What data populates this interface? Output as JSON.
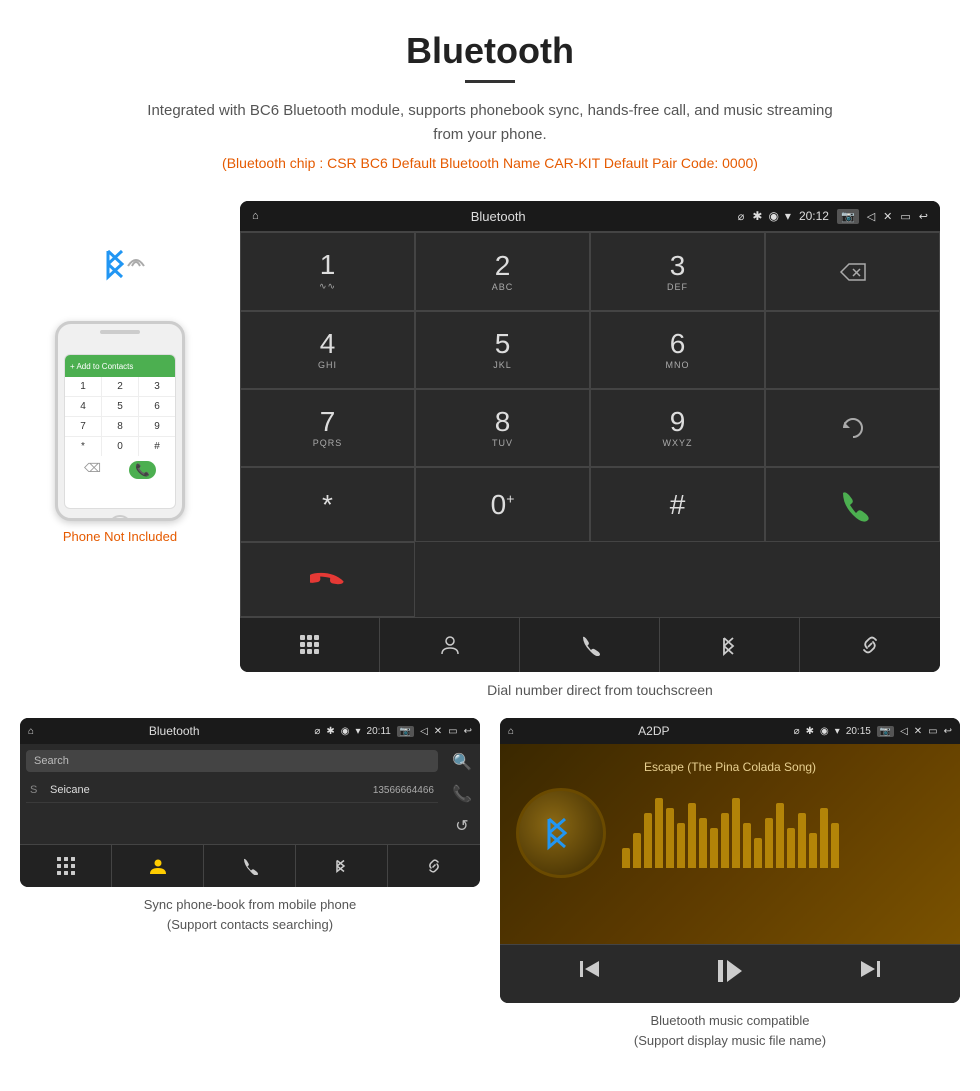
{
  "header": {
    "title": "Bluetooth",
    "description": "Integrated with BC6 Bluetooth module, supports phonebook sync, hands-free call, and music streaming from your phone.",
    "specs": "(Bluetooth chip : CSR BC6    Default Bluetooth Name CAR-KIT    Default Pair Code: 0000)"
  },
  "dial_screen": {
    "status_bar": {
      "home_icon": "⌂",
      "title": "Bluetooth",
      "usb_icon": "⌀",
      "bt_icon": "✱",
      "location_icon": "◉",
      "wifi_icon": "▾",
      "time": "20:12",
      "camera_icon": "⬜",
      "volume_icon": "◁",
      "close_icon": "✕",
      "window_icon": "▭",
      "back_icon": "↩"
    },
    "keys": [
      {
        "num": "1",
        "sub": "∿∿",
        "col": 0,
        "row": 0
      },
      {
        "num": "2",
        "sub": "ABC",
        "col": 1,
        "row": 0
      },
      {
        "num": "3",
        "sub": "DEF",
        "col": 2,
        "row": 0
      },
      {
        "num": "4",
        "sub": "GHI",
        "col": 0,
        "row": 1
      },
      {
        "num": "5",
        "sub": "JKL",
        "col": 1,
        "row": 1
      },
      {
        "num": "6",
        "sub": "MNO",
        "col": 2,
        "row": 1
      },
      {
        "num": "7",
        "sub": "PQRS",
        "col": 0,
        "row": 2
      },
      {
        "num": "8",
        "sub": "TUV",
        "col": 1,
        "row": 2
      },
      {
        "num": "9",
        "sub": "WXYZ",
        "col": 2,
        "row": 2
      },
      {
        "num": "*",
        "sub": "",
        "col": 0,
        "row": 3
      },
      {
        "num": "0⁺",
        "sub": "",
        "col": 1,
        "row": 3
      },
      {
        "num": "#",
        "sub": "",
        "col": 2,
        "row": 3
      }
    ],
    "bottom_icons": [
      "⋮⋮⋮",
      "👤",
      "📞",
      "✱",
      "🔗"
    ],
    "caption": "Dial number direct from touchscreen"
  },
  "phonebook_screen": {
    "status_bar": {
      "home_icon": "⌂",
      "title": "Bluetooth",
      "usb_icon": "⌀",
      "bt_icon": "✱",
      "location_icon": "◉",
      "wifi_icon": "▾",
      "time": "20:11",
      "camera_icon": "⬜",
      "volume_icon": "◁",
      "close_icon": "✕",
      "window_icon": "▭",
      "back_icon": "↩"
    },
    "search_placeholder": "Search",
    "contacts": [
      {
        "letter": "S",
        "name": "Seicane",
        "phone": "13566664466"
      }
    ],
    "bottom_icons": [
      "⋮⋮⋮",
      "👤",
      "📞",
      "✱",
      "🔗"
    ],
    "caption_line1": "Sync phone-book from mobile phone",
    "caption_line2": "(Support contacts searching)"
  },
  "music_screen": {
    "status_bar": {
      "home_icon": "⌂",
      "title": "A2DP",
      "usb_icon": "⌀",
      "bt_icon": "✱",
      "location_icon": "◉",
      "wifi_icon": "▾",
      "time": "20:15",
      "camera_icon": "⬜",
      "volume_icon": "◁",
      "close_icon": "✕",
      "window_icon": "▭",
      "back_icon": "↩"
    },
    "song_name": "Escape (The Pina Colada Song)",
    "eq_bars": [
      20,
      35,
      55,
      70,
      60,
      45,
      65,
      50,
      40,
      55,
      70,
      45,
      30,
      50,
      65,
      40,
      55,
      35,
      60,
      45
    ],
    "controls": [
      "⏮",
      "⏯",
      "⏭"
    ],
    "caption_line1": "Bluetooth music compatible",
    "caption_line2": "(Support display music file name)"
  },
  "phone_area": {
    "not_included_text": "Phone Not Included"
  }
}
